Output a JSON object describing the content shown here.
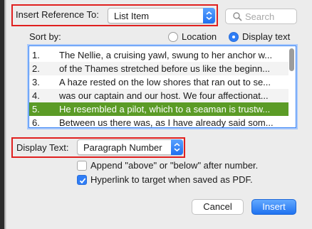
{
  "insert_reference": {
    "label": "Insert Reference To:",
    "value": "List Item"
  },
  "search": {
    "placeholder": "Search"
  },
  "sort": {
    "label": "Sort by:",
    "options": [
      {
        "label": "Location",
        "selected": false
      },
      {
        "label": "Display text",
        "selected": true
      }
    ]
  },
  "list": {
    "items": [
      {
        "num": "1.",
        "text": "The Nellie, a cruising yawl, swung to her anchor w..."
      },
      {
        "num": "2.",
        "text": "of the Thames stretched before us like the beginn..."
      },
      {
        "num": "3.",
        "text": "A haze rested on the low shores that ran out to se..."
      },
      {
        "num": "4.",
        "text": " was our captain and our host. We four affectionat..."
      },
      {
        "num": "5.",
        "text": "He resembled a pilot, which to a seaman is trustw..."
      },
      {
        "num": "6.",
        "text": "Between us there was, as I have already said som..."
      }
    ],
    "selected_index": 4
  },
  "display_text": {
    "label": "Display Text:",
    "value": "Paragraph Number"
  },
  "options": {
    "append": {
      "label": "Append \"above\" or \"below\" after number.",
      "checked": false
    },
    "hyperlink": {
      "label": "Hyperlink to target when saved as PDF.",
      "checked": true
    }
  },
  "buttons": {
    "cancel": "Cancel",
    "insert": "Insert"
  },
  "colors": {
    "highlight_box": "#e0201f",
    "selection": "#5b9b26",
    "accent": "#2f7df6"
  }
}
